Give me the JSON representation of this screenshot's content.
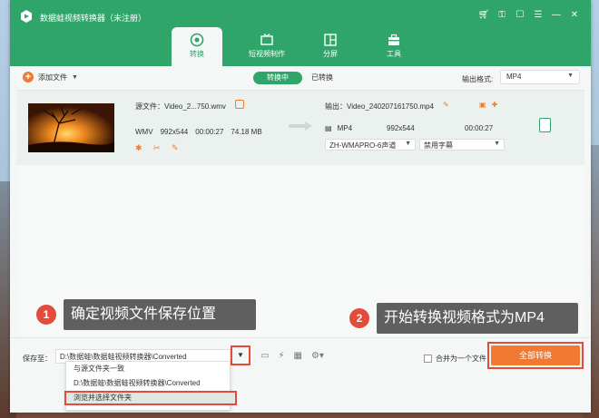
{
  "app": {
    "title": "数据蛙视频转换器（未注册）"
  },
  "tabs": [
    {
      "label": "转换",
      "icon": "convert-icon"
    },
    {
      "label": "短视频制作",
      "icon": "tv-icon"
    },
    {
      "label": "分屏",
      "icon": "split-screen-icon"
    },
    {
      "label": "工具",
      "icon": "toolbox-icon"
    }
  ],
  "toolbar": {
    "add_file_label": "添加文件",
    "seg_converting": "转换中",
    "seg_converted": "已转换",
    "output_format_label": "输出格式:",
    "output_format_value": "MP4"
  },
  "file": {
    "source_name": "源文件：Video_2...750.wmv",
    "format": "WMV",
    "resolution": "992x544",
    "duration": "00:00:27",
    "size": "74.18 MB",
    "output_name": "输出：Video_240207161750.mp4",
    "output_format": "MP4",
    "output_resolution": "992x544",
    "output_duration": "00:00:27",
    "audio_track": "ZH-WMAPRO-6声道",
    "subtitle": "禁用字幕"
  },
  "annotations": [
    {
      "number": "1",
      "text": "确定视频文件保存位置"
    },
    {
      "number": "2",
      "text": "开始转换视频格式为MP4"
    }
  ],
  "bottom": {
    "save_to_label": "保存至：",
    "save_path": "D:\\数据蛙\\数据蛙视频转换器\\Converted",
    "merge_label": "合并为一个文件",
    "convert_all_label": "全部转换"
  },
  "menu": {
    "items": [
      "与源文件夹一致",
      "D:\\数据蛙\\数据蛙视频转换器\\Converted",
      "浏览并选择文件夹"
    ]
  },
  "colors": {
    "brand_green": "#2fa56a",
    "accent_orange": "#f07a32",
    "highlight_red": "#e34b3a"
  }
}
